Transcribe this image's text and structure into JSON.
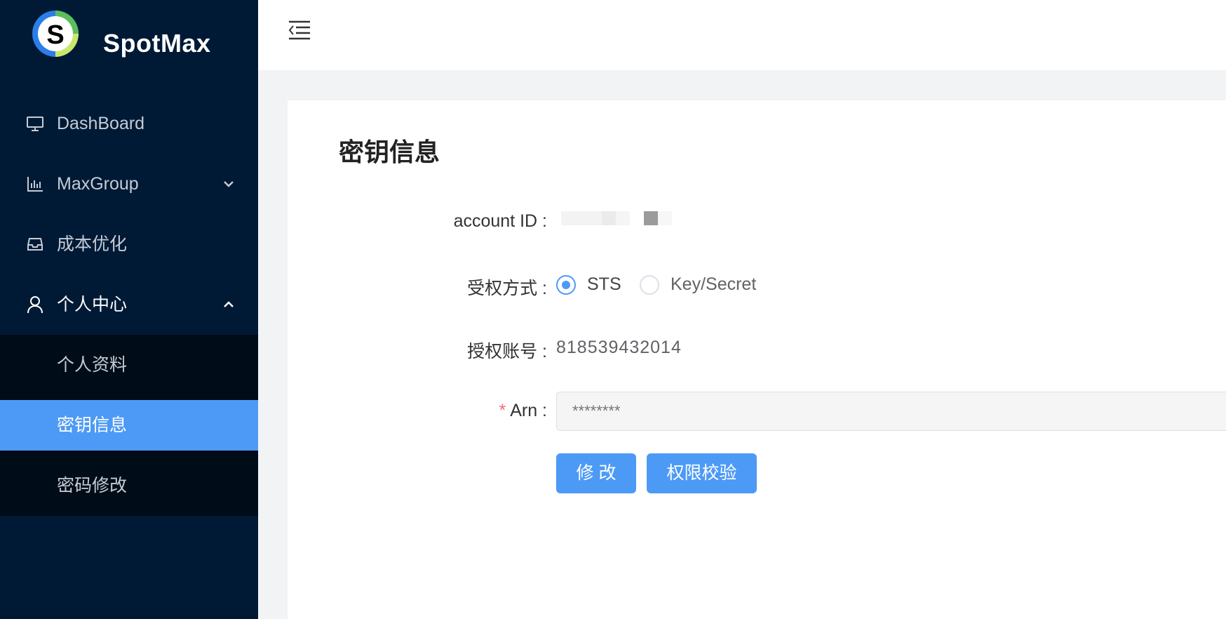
{
  "brand": {
    "name": "SpotMax"
  },
  "sidebar": {
    "items": [
      {
        "label": "DashBoard",
        "icon": "monitor-icon"
      },
      {
        "label": "MaxGroup",
        "icon": "bar-chart-icon",
        "arrow": "chevron-down-icon"
      },
      {
        "label": "成本优化",
        "icon": "inbox-icon"
      },
      {
        "label": "个人中心",
        "icon": "user-icon",
        "arrow": "chevron-up-icon"
      }
    ],
    "subitems": [
      {
        "label": "个人资料"
      },
      {
        "label": "密钥信息",
        "active": true
      },
      {
        "label": "密码修改"
      }
    ]
  },
  "header": {
    "toggle_icon": "menu-fold-icon"
  },
  "main": {
    "title": "密钥信息",
    "form": {
      "account_id_label": "account ID :",
      "auth_method_label": "受权方式 :",
      "auth_options": [
        "STS",
        "Key/Secret"
      ],
      "auth_selected": "STS",
      "auth_account_label": "授权账号 :",
      "auth_account_value": "818539432014",
      "arn_required_mark": "*",
      "arn_label": "Arn :",
      "arn_placeholder": "********",
      "modify_button": "修 改",
      "verify_button": "权限校验"
    }
  },
  "colors": {
    "sidebar_bg": "#001a35",
    "submenu_bg": "#000c18",
    "accent": "#4d9af6",
    "required": "#f56c6c"
  }
}
